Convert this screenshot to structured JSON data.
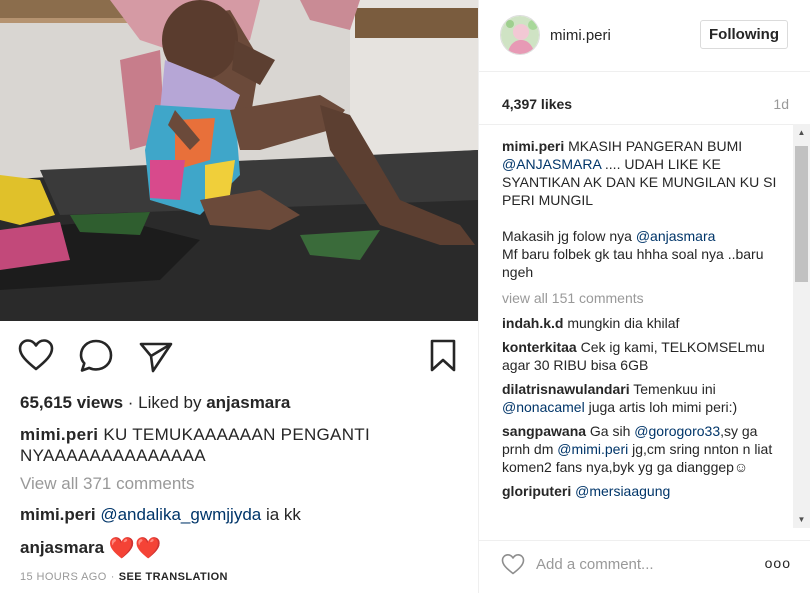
{
  "icons": {
    "heart": "heart-icon",
    "comment": "comment-icon",
    "share": "share-icon",
    "bookmark": "bookmark-icon",
    "more": "more-icon"
  },
  "mobile": {
    "views_count": "65,615 views",
    "liked_by_prefix": "Liked by",
    "liked_by_user": "anjasmara",
    "caption": {
      "user": "mimi.peri",
      "text": "KU TEMUKAAAAAAN PENGANTI NYAAAAAAAAAAAAAA"
    },
    "view_all": "View all 371 comments",
    "comments": [
      {
        "user": "mimi.peri",
        "mention": "@andalika_gwmjjyda",
        "text": "ia kk"
      },
      {
        "user": "anjasmara",
        "text": "❤️❤️"
      }
    ],
    "meta": {
      "time": "15 HOURS AGO",
      "translate": "SEE TRANSLATION"
    }
  },
  "post": {
    "username": "mimi.peri",
    "follow_label": "Following",
    "likes": "4,397 likes",
    "age": "1d",
    "caption": {
      "user": "mimi.peri",
      "line1_pre": "MKASIH PANGERAN BUMI",
      "line1_mention": "@ANJASMARA",
      "line1_post": ".... UDAH LIKE KE SYANTIKAN AK DAN KE MUNGILAN KU SI PERI MUNGIL",
      "line2_pre": "Makasih jg folow nya",
      "line2_mention": "@anjasmara",
      "line3": "Mf baru folbek gk tau hhha soal nya ..baru ngeh"
    },
    "view_all": "view all 151 comments",
    "comments": [
      {
        "user": "indah.k.d",
        "mention": "",
        "text": "mungkin dia khilaf"
      },
      {
        "user": "konterkitaa",
        "mention": "",
        "text": "Cek ig kami, TELKOMSELmu agar 30 RIBU bisa 6GB"
      },
      {
        "user": "dilatrisnawulandari",
        "text_pre": "Temenkuu ini",
        "mention": "@nonacamel",
        "text": "juga artis loh mimi peri:)"
      },
      {
        "user": "sangpawana",
        "text_pre": "Ga sih",
        "mention": "@gorogoro33",
        "text_mid": ",sy ga prnh dm",
        "mention2": "@mimi.peri",
        "text": "jg,cm sring nnton n liat komen2 fans nya,byk yg ga dianggep☺"
      },
      {
        "user": "gloriputeri",
        "mention": "@mersiaagung",
        "text": ""
      }
    ],
    "add_comment_placeholder": "Add a comment...",
    "more_label": "ooo"
  }
}
